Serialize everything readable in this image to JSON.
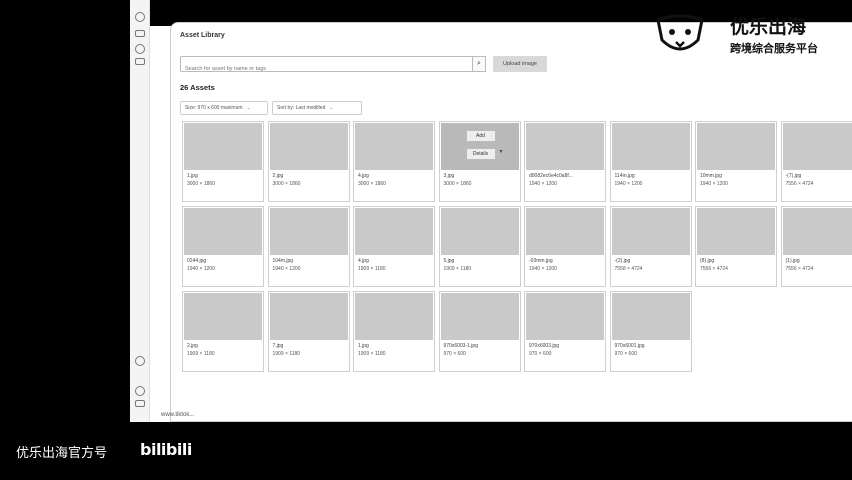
{
  "panel": {
    "title": "Asset Library",
    "search_placeholder": "Search for asset by name or tags",
    "search_icon": "search-icon",
    "upload_label": "Upload image",
    "count_label": "26 Assets",
    "filters": [
      {
        "label": "Size: 970 x 600 maximum"
      },
      {
        "label": "Sort by: Last modified"
      }
    ]
  },
  "hover": {
    "add_label": "Add",
    "details_label": "Details"
  },
  "assets": [
    {
      "name": "1.jpg",
      "size": "3000 × 1860"
    },
    {
      "name": "2.jpg",
      "size": "3000 × 1860"
    },
    {
      "name": "4.jpg",
      "size": "3000 × 1860"
    },
    {
      "name": "3.jpg",
      "size": "3000 × 1860"
    },
    {
      "name": "d0082ec6e4c0a8f...",
      "size": "1940 × 1200"
    },
    {
      "name": "114m.jpg",
      "size": "1940 × 1200"
    },
    {
      "name": "10mm.jpg",
      "size": "1940 × 1200"
    },
    {
      "name": "-(7).jpg",
      "size": "7556 × 4724"
    },
    {
      "name": "0244.jpg",
      "size": "1940 × 1200"
    },
    {
      "name": "104m.jpg",
      "size": "1940 × 1200"
    },
    {
      "name": "4.jpg",
      "size": "1909 × 1180"
    },
    {
      "name": "5.jpg",
      "size": "1909 × 1180"
    },
    {
      "name": "-03mm.jpg",
      "size": "1940 × 1200"
    },
    {
      "name": "-(2).jpg",
      "size": "7558 × 4724"
    },
    {
      "name": "(8).jpg",
      "size": "7556 × 4724"
    },
    {
      "name": "(1).jpg",
      "size": "7556 × 4724"
    },
    {
      "name": "2.jpg",
      "size": "1909 × 1180"
    },
    {
      "name": "7.jpg",
      "size": "1909 × 1180"
    },
    {
      "name": "1.jpg",
      "size": "1909 × 1180"
    },
    {
      "name": "970x6003-1.jpg",
      "size": "970 × 600"
    },
    {
      "name": "970x6003.jpg",
      "size": "970 × 600"
    },
    {
      "name": "970x6001.jpg",
      "size": "970 × 600"
    }
  ],
  "overlay": {
    "brand_title": "优乐出海",
    "brand_subtitle": "跨境综合服务平台",
    "watermark": "优乐出海官方号",
    "bili": "bilibili"
  },
  "status_text": "www.tiktok..."
}
